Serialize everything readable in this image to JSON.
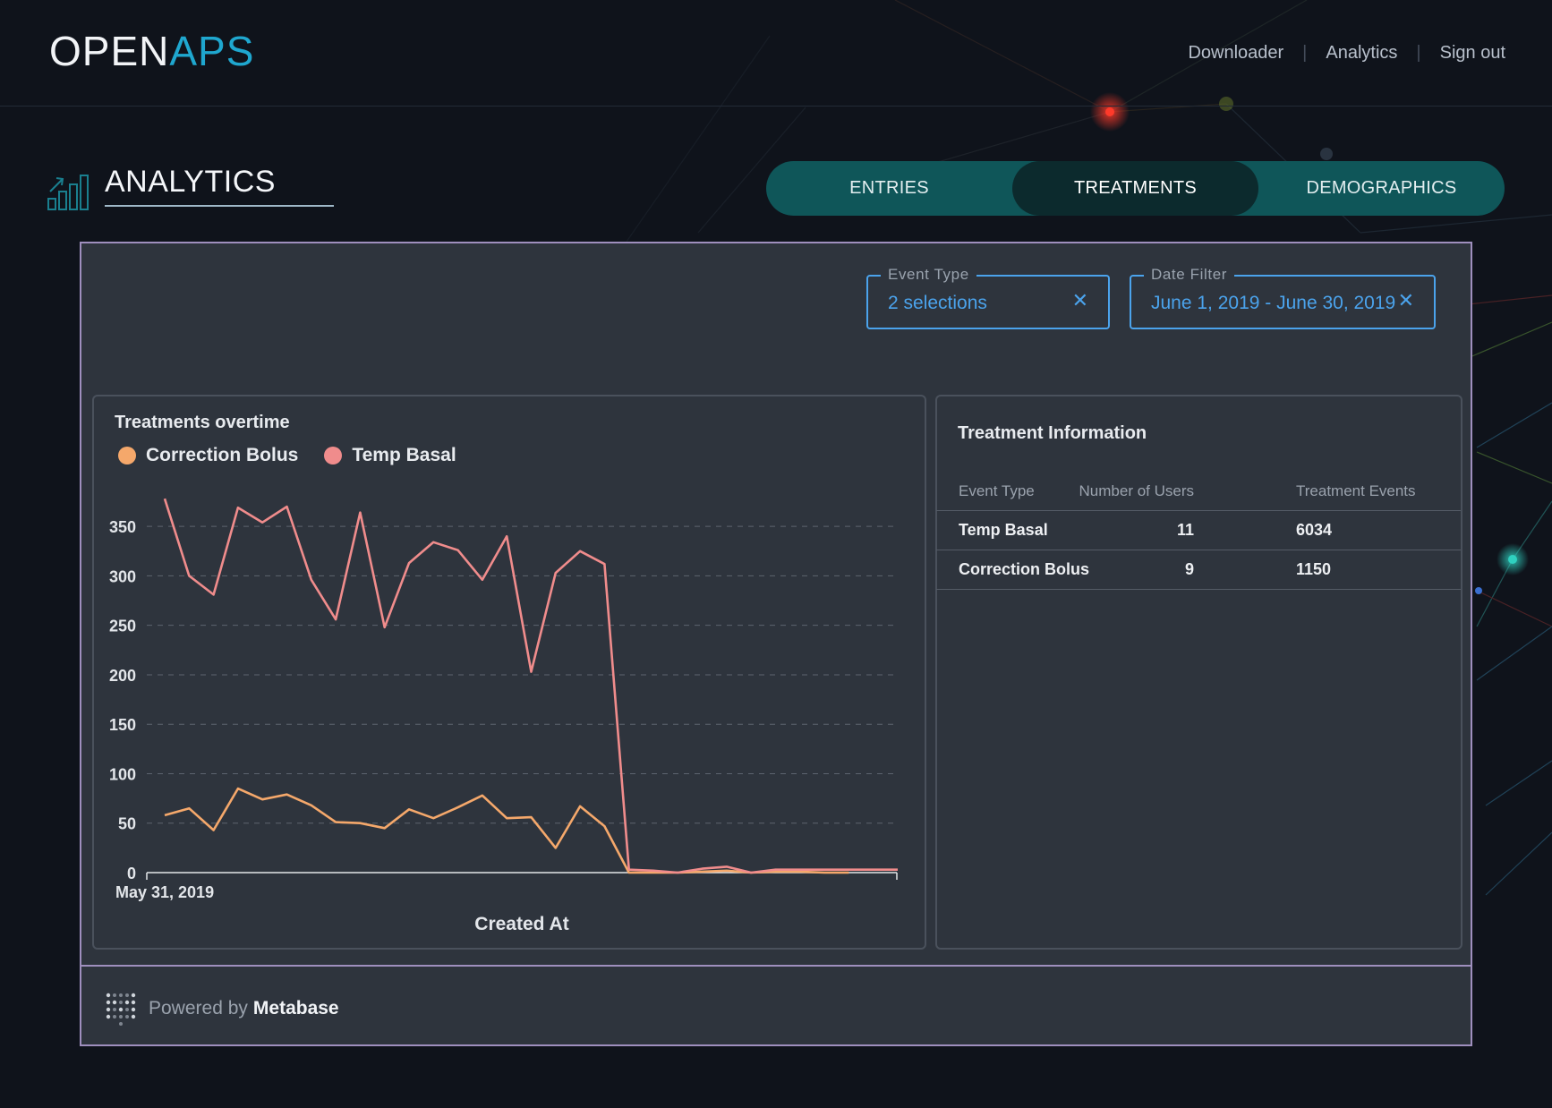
{
  "header": {
    "logo_part1": "OPEN",
    "logo_part2": "APS",
    "nav": [
      {
        "label": "Downloader"
      },
      {
        "label": "Analytics"
      },
      {
        "label": "Sign out"
      }
    ]
  },
  "page": {
    "title": "ANALYTICS",
    "icon": "bar-chart-trend-icon"
  },
  "tabs": [
    {
      "label": "ENTRIES",
      "active": false
    },
    {
      "label": "TREATMENTS",
      "active": true
    },
    {
      "label": "DEMOGRAPHICS",
      "active": false
    }
  ],
  "filters": {
    "event_type": {
      "label": "Event Type",
      "value": "2 selections",
      "clear": "✕"
    },
    "date_filter": {
      "label": "Date Filter",
      "value": "June 1, 2019 - June 30, 2019",
      "clear": "✕"
    }
  },
  "chart": {
    "title": "Treatments overtime",
    "legend": [
      {
        "name": "Correction Bolus",
        "color": "#f5a86b"
      },
      {
        "name": "Temp Basal",
        "color": "#f08c8c"
      }
    ]
  },
  "chart_data": {
    "type": "line",
    "title": "Treatments overtime",
    "xlabel": "Created At",
    "ylabel": "",
    "x_tick_labels": [
      "May 31, 2019"
    ],
    "yticks": [
      0,
      50,
      100,
      150,
      200,
      250,
      300,
      350
    ],
    "ylim": [
      0,
      380
    ],
    "grid": true,
    "legend_position": "top-left",
    "x": [
      0,
      1,
      2,
      3,
      4,
      5,
      6,
      7,
      8,
      9,
      10,
      11,
      12,
      13,
      14,
      15,
      16,
      17,
      18,
      19,
      20,
      21,
      22,
      23,
      24,
      25,
      26,
      27,
      28,
      29,
      30
    ],
    "series": [
      {
        "name": "Temp Basal",
        "color": "#f08c8c",
        "values": [
          378,
          300,
          281,
          369,
          354,
          370,
          296,
          256,
          364,
          248,
          313,
          334,
          326,
          296,
          340,
          203,
          303,
          325,
          312,
          3,
          2,
          0,
          4,
          6,
          0,
          3,
          3,
          3,
          3,
          3,
          3
        ]
      },
      {
        "name": "Correction Bolus",
        "color": "#f5a86b",
        "values": [
          58,
          65,
          43,
          85,
          74,
          79,
          68,
          51,
          50,
          45,
          64,
          55,
          66,
          78,
          55,
          56,
          25,
          67,
          47,
          0,
          0,
          0,
          1,
          2,
          0,
          1,
          1,
          0,
          0,
          null,
          null
        ]
      }
    ]
  },
  "table": {
    "title": "Treatment Information",
    "columns": [
      "Event Type",
      "Number of Users",
      "Treatment Events"
    ],
    "rows": [
      [
        "Temp Basal",
        "11",
        "6034"
      ],
      [
        "Correction Bolus",
        "9",
        "1150"
      ]
    ]
  },
  "footer": {
    "powered_by": "Powered by",
    "brand": "Metabase"
  },
  "colors": {
    "accent": "#1fa7cf",
    "tab_bg": "#0f5659",
    "tab_active": "#0c2a2d",
    "filter_blue": "#4ba3ec",
    "frame_border": "#9f8fbe"
  }
}
